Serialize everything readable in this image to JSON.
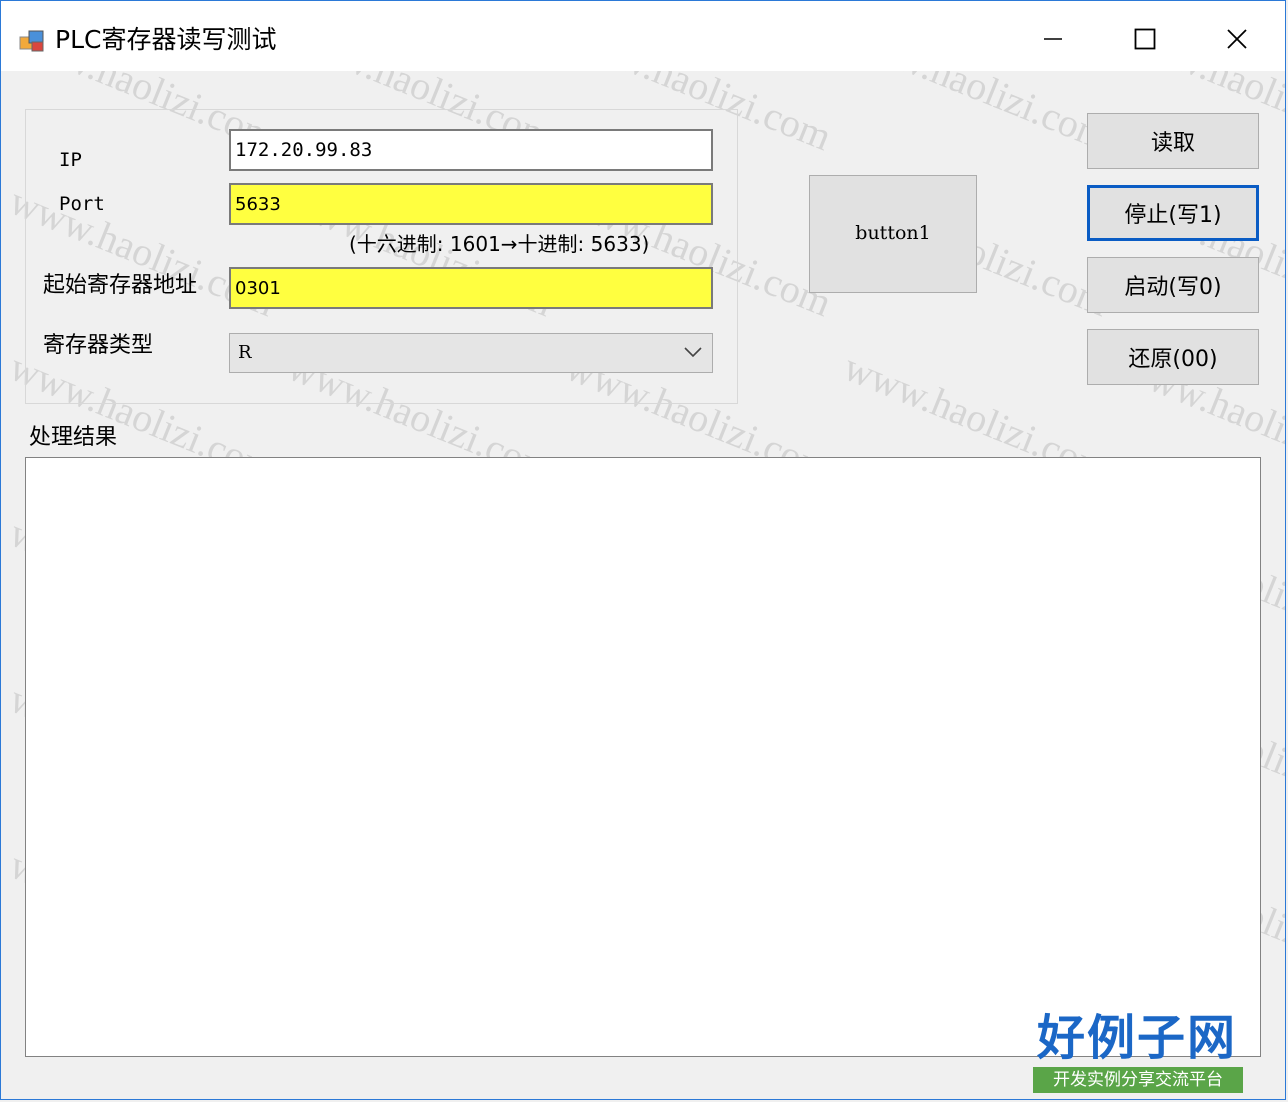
{
  "window": {
    "title": "PLC寄存器读写测试",
    "controls": {
      "minimize": "–",
      "maximize": "□",
      "close": "×"
    }
  },
  "form": {
    "ip_label": "IP",
    "ip_value": "172.20.99.83",
    "port_label": "Port",
    "port_value": "5633",
    "port_note": "(十六进制: 1601→十进制: 5633)",
    "start_register_label": "起始寄存器地址",
    "start_register_value": "0301",
    "register_type_label": "寄存器类型",
    "register_type_value": "R"
  },
  "buttons": {
    "big": "button1",
    "read": "读取",
    "stop": "停止(写1)",
    "start": "启动(写0)",
    "restore": "还原(00)"
  },
  "result": {
    "label": "处理结果",
    "content": ""
  },
  "watermark": {
    "text": "www.haolizi.com",
    "logo_main": "好例子网",
    "logo_sub": "开发实例分享交流平台"
  },
  "colors": {
    "highlight_yellow": "#ffff40",
    "focus_blue": "#0a5cc4",
    "window_border": "#2b79d7"
  }
}
